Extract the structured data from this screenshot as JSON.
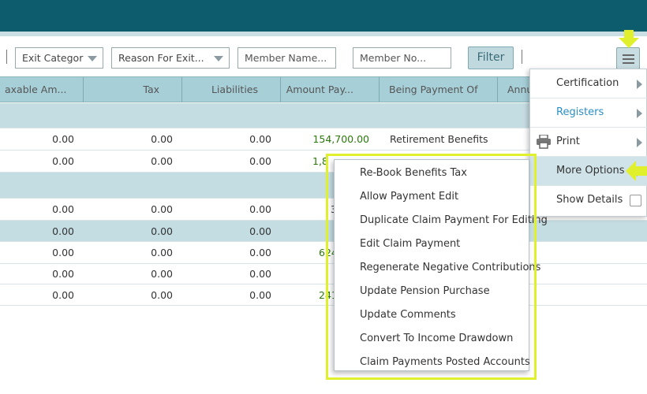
{
  "toolbar": {
    "exit_category": "Exit Categor",
    "reason_placeholder": "Reason For Exit...",
    "member_name_placeholder": "Member Name...",
    "member_no_placeholder": "Member No...",
    "filter_label": "Filter"
  },
  "table": {
    "columns": [
      "axable Am...",
      "Tax",
      "Liabilities",
      "Amount Pay...",
      "Being Payment Of",
      "Annu"
    ],
    "rows": [
      {
        "type": "group"
      },
      {
        "type": "data",
        "taxable": "0.00",
        "tax": "0.00",
        "liabilities": "0.00",
        "amount": "154,700.00",
        "being": "Retirement Benefits"
      },
      {
        "type": "data",
        "taxable": "0.00",
        "tax": "0.00",
        "liabilities": "0.00",
        "amount": "1,8",
        "being": ""
      },
      {
        "type": "group"
      },
      {
        "type": "data",
        "taxable": "0.00",
        "tax": "0.00",
        "liabilities": "0.00",
        "amount": "3",
        "being": ""
      },
      {
        "type": "group",
        "taxable": "0.00",
        "tax": "0.00",
        "liabilities": "0.00"
      },
      {
        "type": "data",
        "taxable": "0.00",
        "tax": "0.00",
        "liabilities": "0.00",
        "amount": "624",
        "being": ""
      },
      {
        "type": "data",
        "taxable": "0.00",
        "tax": "0.00",
        "liabilities": "0.00",
        "amount": "",
        "being": ""
      },
      {
        "type": "data",
        "taxable": "0.00",
        "tax": "0.00",
        "liabilities": "0.00",
        "amount": "241",
        "being": ""
      }
    ]
  },
  "options_menu": {
    "items": [
      {
        "label": "Certification",
        "has_submenu": true
      },
      {
        "label": "Registers",
        "has_submenu": true
      },
      {
        "label": "Print",
        "has_submenu": true,
        "icon": "printer-icon"
      },
      {
        "label": "More Options",
        "has_submenu": true
      },
      {
        "label": "Show Details",
        "checkbox": true,
        "checked": false
      }
    ]
  },
  "more_options_submenu": {
    "items": [
      "Re-Book Benefits Tax",
      "Allow Payment Edit",
      "Duplicate Claim Payment For Editing",
      "Edit Claim Payment",
      "Regenerate Negative Contributions",
      "Update Pension Purchase",
      "Update Comments",
      "Convert To Income Drawdown",
      "Claim Payments Posted Accounts"
    ]
  },
  "colors": {
    "header_bar": "#0d5c6e",
    "table_header": "#a7cfd8",
    "amount_green": "#2b7a0b",
    "registers_blue": "#2a8fc6",
    "annotation_yellow": "#e1f02d"
  }
}
